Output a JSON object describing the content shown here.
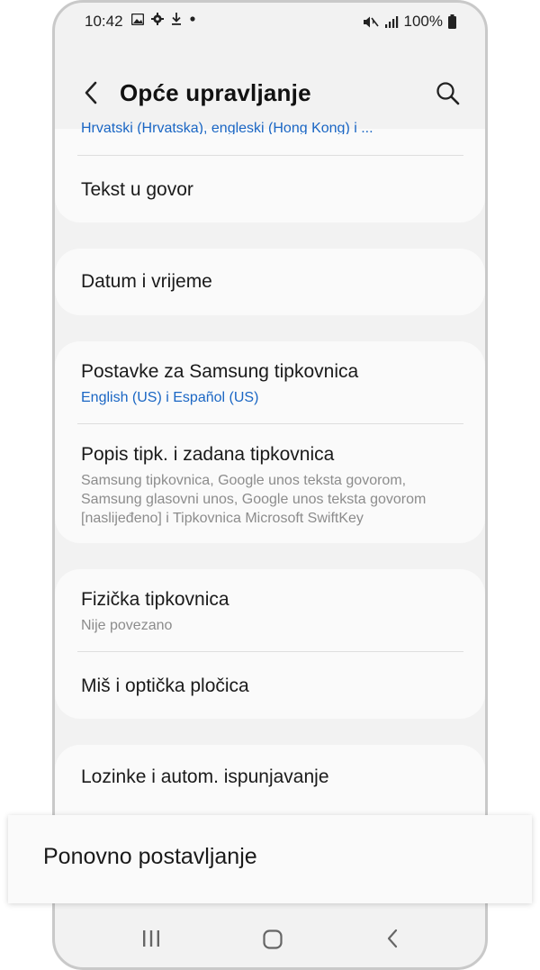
{
  "status_bar": {
    "time": "10:42",
    "battery": "100%",
    "icons": [
      "image-icon",
      "gear-icon",
      "download-icon",
      "dot-icon",
      "mute-icon",
      "signal-icon",
      "battery-icon"
    ]
  },
  "header": {
    "title": "Opće upravljanje"
  },
  "list": {
    "partial_subtitle": "Hrvatski (Hrvatska), engleski (Hong Kong) i ...",
    "items": [
      {
        "title": "Tekst u govor"
      },
      {
        "title": "Datum i vrijeme"
      },
      {
        "title": "Postavke za Samsung tipkovnica",
        "subtitle": "English (US) i Español (US)"
      },
      {
        "title": "Popis tipk. i zadana tipkovnica",
        "subtitle": "Samsung tipkovnica, Google unos teksta govorom, Samsung glasovni unos, Google unos teksta govorom [naslijeđeno] i Tipkovnica Microsoft SwiftKey"
      },
      {
        "title": "Fizička tipkovnica",
        "subtitle": "Nije povezano"
      },
      {
        "title": "Miš i optička pločica"
      },
      {
        "title": "Lozinke i autom. ispunjavanje"
      }
    ]
  },
  "highlight": {
    "title": "Ponovno postavljanje"
  },
  "accent_color": "#1a66c4"
}
